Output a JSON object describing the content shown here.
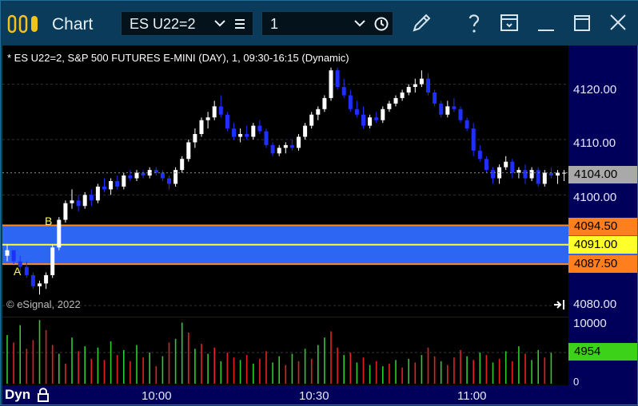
{
  "app": {
    "title": "Chart",
    "symbol_value": "ES U22=2",
    "interval_value": "1"
  },
  "chart": {
    "header": "* ES U22=2, S&P 500 FUTURES E-MINI (DAY), 1, 09:30-16:15 (Dynamic)",
    "watermark": "© eSignal, 2022",
    "mode_label": "Dyn",
    "zone_labels": {
      "a": "A",
      "b": "B"
    },
    "price_ticks": [
      "4120.00",
      "4110.00",
      "4100.00",
      "4080.00"
    ],
    "tags": {
      "last": "4104.00",
      "upper": "4094.50",
      "mid": "4091.00",
      "lower": "4087.50"
    },
    "volume_ticks": [
      "10000",
      "0"
    ],
    "volume_last": "4954",
    "time_labels": [
      "10:00",
      "10:30",
      "11:00"
    ],
    "colors": {
      "up": "#ffffff",
      "down": "#1f2fff",
      "zone": "#2f6bff",
      "zone_edge": "#ff8a1e",
      "zone_mid": "#ffff40",
      "vol_up": "#2ecc2e",
      "vol_down": "#e62020"
    }
  },
  "chart_data": {
    "type": "candlestick",
    "title": "* ES U22=2, S&P 500 FUTURES E-MINI (DAY), 1, 09:30-16:15 (Dynamic)",
    "ylim": [
      4078,
      4127
    ],
    "y_ticks": [
      4120,
      4110,
      4100,
      4080
    ],
    "zone": {
      "upper": 4094.5,
      "mid": 4091.0,
      "lower": 4087.5
    },
    "last_price": 4104.0,
    "volume_ylim": [
      0,
      10500
    ],
    "last_volume": 4954,
    "x_labels": [
      "10:00",
      "10:30",
      "11:00"
    ],
    "candles": [
      [
        4089,
        4091,
        4088,
        4090
      ],
      [
        4090,
        4090,
        4087.5,
        4088
      ],
      [
        4088,
        4089,
        4086,
        4087
      ],
      [
        4087,
        4088,
        4085,
        4085.5
      ],
      [
        4085.5,
        4086,
        4083,
        4083.5
      ],
      [
        4083.5,
        4084.5,
        4082,
        4084
      ],
      [
        4084,
        4086,
        4083,
        4085.5
      ],
      [
        4085.5,
        4091,
        4085,
        4090.5
      ],
      [
        4090.5,
        4096,
        4090,
        4095.5
      ],
      [
        4095.5,
        4099,
        4095,
        4098.5
      ],
      [
        4098.5,
        4101,
        4097.5,
        4099
      ],
      [
        4099,
        4100,
        4097,
        4098
      ],
      [
        4098,
        4100.5,
        4097.5,
        4100
      ],
      [
        4100,
        4101,
        4098,
        4099
      ],
      [
        4099,
        4102,
        4098.5,
        4101.5
      ],
      [
        4101.5,
        4103,
        4100.5,
        4101
      ],
      [
        4101,
        4103,
        4100,
        4102.5
      ],
      [
        4102.5,
        4103.5,
        4101,
        4101.5
      ],
      [
        4101.5,
        4104,
        4101,
        4103.5
      ],
      [
        4103.5,
        4104.5,
        4102.5,
        4103
      ],
      [
        4103,
        4104.5,
        4102.5,
        4104
      ],
      [
        4104,
        4104.5,
        4103,
        4103.5
      ],
      [
        4103.5,
        4105,
        4103,
        4104.5
      ],
      [
        4104.5,
        4105,
        4103.5,
        4104
      ],
      [
        4104,
        4104.5,
        4102.5,
        4103
      ],
      [
        4103,
        4103.5,
        4101,
        4102
      ],
      [
        4102,
        4105,
        4101.5,
        4104.5
      ],
      [
        4104.5,
        4107,
        4104,
        4106.5
      ],
      [
        4106.5,
        4110,
        4106,
        4109.5
      ],
      [
        4109.5,
        4112,
        4108.5,
        4111
      ],
      [
        4111,
        4114,
        4110.5,
        4113.5
      ],
      [
        4113.5,
        4115,
        4112,
        4114
      ],
      [
        4114,
        4117,
        4113.5,
        4116
      ],
      [
        4116,
        4118,
        4114,
        4114.5
      ],
      [
        4114.5,
        4115,
        4111.5,
        4112
      ],
      [
        4112,
        4113,
        4110,
        4110.5
      ],
      [
        4110.5,
        4112,
        4109.5,
        4111
      ],
      [
        4111,
        4112.5,
        4110,
        4110.5
      ],
      [
        4110.5,
        4113,
        4110,
        4112.5
      ],
      [
        4112.5,
        4113.5,
        4111,
        4111.5
      ],
      [
        4111.5,
        4112,
        4108.5,
        4109
      ],
      [
        4109,
        4109.5,
        4107,
        4107.5
      ],
      [
        4107.5,
        4109,
        4107,
        4108.5
      ],
      [
        4108.5,
        4109.5,
        4107.5,
        4109
      ],
      [
        4109,
        4110,
        4108,
        4108.5
      ],
      [
        4108.5,
        4111,
        4108,
        4110.5
      ],
      [
        4110.5,
        4113,
        4110,
        4112.5
      ],
      [
        4112.5,
        4115,
        4112,
        4114.5
      ],
      [
        4114.5,
        4116,
        4113.5,
        4115.5
      ],
      [
        4115.5,
        4118,
        4115,
        4117.5
      ],
      [
        4117.5,
        4123,
        4117,
        4122.5
      ],
      [
        4122.5,
        4123,
        4119,
        4119.5
      ],
      [
        4119.5,
        4121,
        4117.5,
        4118
      ],
      [
        4118,
        4119,
        4115,
        4115.5
      ],
      [
        4115.5,
        4117,
        4114,
        4114.5
      ],
      [
        4114.5,
        4116,
        4112,
        4112.5
      ],
      [
        4112.5,
        4114.5,
        4112,
        4114
      ],
      [
        4114,
        4115,
        4113,
        4113.5
      ],
      [
        4113.5,
        4116,
        4113,
        4115.5
      ],
      [
        4115.5,
        4117,
        4115,
        4116.5
      ],
      [
        4116.5,
        4118,
        4116,
        4117.5
      ],
      [
        4117.5,
        4119,
        4117,
        4118.5
      ],
      [
        4118.5,
        4120,
        4118,
        4119.5
      ],
      [
        4119.5,
        4121,
        4118.5,
        4120
      ],
      [
        4120,
        4122.5,
        4119.5,
        4121
      ],
      [
        4121,
        4122,
        4118,
        4118.5
      ],
      [
        4118.5,
        4119,
        4116,
        4116.5
      ],
      [
        4116.5,
        4117,
        4114,
        4114.5
      ],
      [
        4114.5,
        4117,
        4114,
        4116
      ],
      [
        4116,
        4117.5,
        4115,
        4115.5
      ],
      [
        4115.5,
        4116,
        4113,
        4113.5
      ],
      [
        4113.5,
        4114,
        4111.5,
        4112
      ],
      [
        4112,
        4113,
        4107,
        4108
      ],
      [
        4108,
        4109,
        4106,
        4106.5
      ],
      [
        4106.5,
        4107,
        4104,
        4104.5
      ],
      [
        4104.5,
        4105,
        4102,
        4103
      ],
      [
        4103,
        4105.5,
        4102,
        4105
      ],
      [
        4105,
        4107,
        4104.5,
        4106
      ],
      [
        4106,
        4106.5,
        4103,
        4104
      ],
      [
        4104,
        4105,
        4103,
        4104.5
      ],
      [
        4104.5,
        4105.5,
        4102,
        4103
      ],
      [
        4103,
        4105,
        4102.5,
        4104.5
      ],
      [
        4104.5,
        4105,
        4101.5,
        4102
      ],
      [
        4102,
        4104.5,
        4101.5,
        4104
      ],
      [
        4104,
        4105,
        4103,
        4103.5
      ],
      [
        4103.5,
        4104.5,
        4102,
        4104
      ],
      [
        4104,
        4104.5,
        4102.5,
        4104
      ]
    ],
    "volume": [
      [
        7800,
        0
      ],
      [
        6600,
        1
      ],
      [
        9400,
        0
      ],
      [
        5600,
        1
      ],
      [
        7000,
        1
      ],
      [
        10200,
        0
      ],
      [
        8600,
        1
      ],
      [
        6200,
        1
      ],
      [
        4800,
        0
      ],
      [
        3200,
        1
      ],
      [
        7400,
        0
      ],
      [
        5200,
        1
      ],
      [
        6000,
        0
      ],
      [
        4000,
        1
      ],
      [
        5800,
        0
      ],
      [
        3800,
        1
      ],
      [
        6800,
        0
      ],
      [
        4600,
        1
      ],
      [
        5400,
        0
      ],
      [
        3600,
        1
      ],
      [
        6200,
        0
      ],
      [
        4200,
        1
      ],
      [
        5000,
        0
      ],
      [
        2800,
        1
      ],
      [
        4400,
        0
      ],
      [
        6600,
        1
      ],
      [
        7200,
        0
      ],
      [
        9800,
        0
      ],
      [
        8200,
        1
      ],
      [
        5600,
        0
      ],
      [
        6400,
        1
      ],
      [
        4800,
        0
      ],
      [
        5800,
        1
      ],
      [
        3600,
        0
      ],
      [
        5000,
        1
      ],
      [
        4200,
        1
      ],
      [
        3800,
        0
      ],
      [
        4600,
        1
      ],
      [
        3200,
        0
      ],
      [
        4000,
        1
      ],
      [
        5200,
        1
      ],
      [
        3400,
        0
      ],
      [
        4400,
        0
      ],
      [
        3000,
        1
      ],
      [
        4800,
        0
      ],
      [
        3600,
        1
      ],
      [
        5600,
        0
      ],
      [
        4000,
        1
      ],
      [
        6200,
        0
      ],
      [
        7400,
        0
      ],
      [
        8400,
        1
      ],
      [
        5800,
        1
      ],
      [
        4600,
        0
      ],
      [
        5000,
        1
      ],
      [
        3400,
        0
      ],
      [
        4200,
        1
      ],
      [
        3000,
        0
      ],
      [
        3600,
        1
      ],
      [
        2800,
        0
      ],
      [
        3200,
        1
      ],
      [
        3800,
        0
      ],
      [
        2600,
        1
      ],
      [
        4000,
        0
      ],
      [
        3400,
        1
      ],
      [
        4600,
        0
      ],
      [
        5800,
        1
      ],
      [
        4400,
        1
      ],
      [
        3600,
        0
      ],
      [
        3000,
        1
      ],
      [
        4200,
        1
      ],
      [
        5400,
        1
      ],
      [
        4400,
        0
      ],
      [
        3800,
        1
      ],
      [
        5000,
        0
      ],
      [
        4600,
        1
      ],
      [
        3400,
        0
      ],
      [
        4000,
        1
      ],
      [
        5200,
        0
      ],
      [
        3600,
        1
      ],
      [
        6000,
        0
      ],
      [
        4800,
        1
      ],
      [
        3800,
        0
      ],
      [
        5400,
        0
      ],
      [
        4200,
        1
      ],
      [
        4954,
        0
      ]
    ]
  }
}
